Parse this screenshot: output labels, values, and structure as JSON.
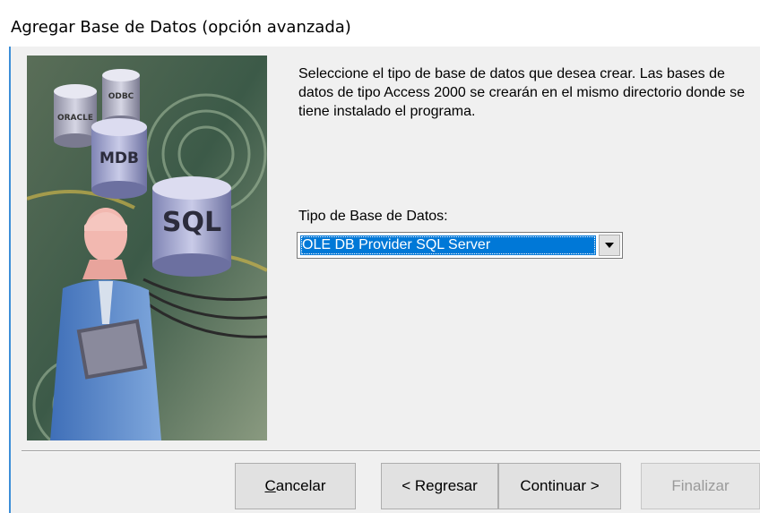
{
  "window": {
    "title": "Agregar Base de Datos (opción avanzada)"
  },
  "illustration": {
    "labels": [
      "ORACLE",
      "ODBC",
      "MDB",
      "SQL"
    ]
  },
  "instructions": "Seleccione el tipo de base de datos que desea crear. Las bases de datos de tipo Access 2000 se crearán en el mismo directorio donde se tiene instalado el programa.",
  "database_type": {
    "label": "Tipo de Base de Datos:",
    "selected": "OLE DB Provider SQL Server"
  },
  "buttons": {
    "cancel_mnemonic": "C",
    "cancel_rest": "ancelar",
    "back": "< Regresar",
    "next": "Continuar >",
    "finish": "Finalizar"
  },
  "colors": {
    "selection": "#0078d7",
    "window_border": "#3c8ed8",
    "dialog_background": "#f0f0f0"
  },
  "icons": {
    "combo_arrow": "chevron-down-icon"
  }
}
